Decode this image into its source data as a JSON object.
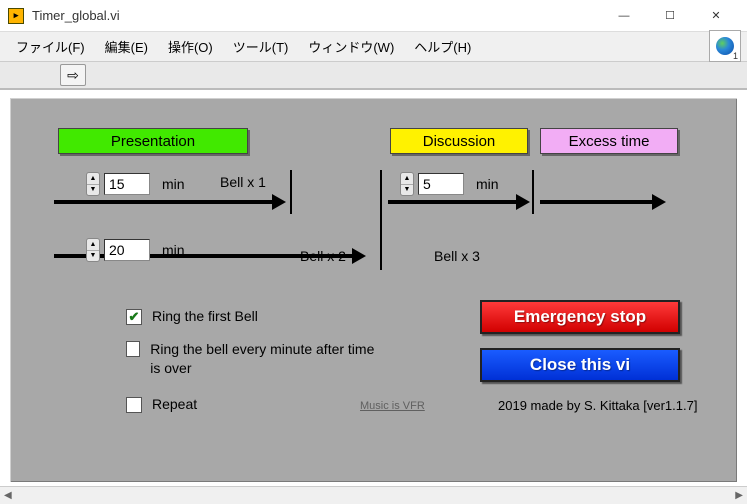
{
  "window": {
    "title": "Timer_global.vi",
    "globe_badge": "1"
  },
  "menu": {
    "file": "ファイル(F)",
    "edit": "編集(E)",
    "operate": "操作(O)",
    "tools": "ツール(T)",
    "window": "ウィンドウ(W)",
    "help": "ヘルプ(H)"
  },
  "toolbar": {
    "run_icon": "⇨"
  },
  "phases": {
    "presentation": "Presentation",
    "discussion": "Discussion",
    "excess": "Excess time"
  },
  "timers": {
    "bell1_minutes": "15",
    "bell2_minutes": "20",
    "discussion_minutes": "5",
    "unit": "min",
    "bell1_label": "Bell x 1",
    "bell2_label": "Bell x 2",
    "bell3_label": "Bell x 3"
  },
  "options": {
    "ring_first": {
      "checked": true,
      "label": "Ring the first Bell"
    },
    "ring_every_minute": {
      "checked": false,
      "label": "Ring the bell every minute after time is over"
    },
    "repeat": {
      "checked": false,
      "label": "Repeat"
    }
  },
  "buttons": {
    "emergency": "Emergency stop",
    "close": "Close this vi"
  },
  "footer": {
    "music_credit": "Music is VFR",
    "credit": "2019 made by S. Kittaka [ver1.1.7]"
  },
  "winctl": {
    "min": "—",
    "max": "☐",
    "close": "✕"
  }
}
